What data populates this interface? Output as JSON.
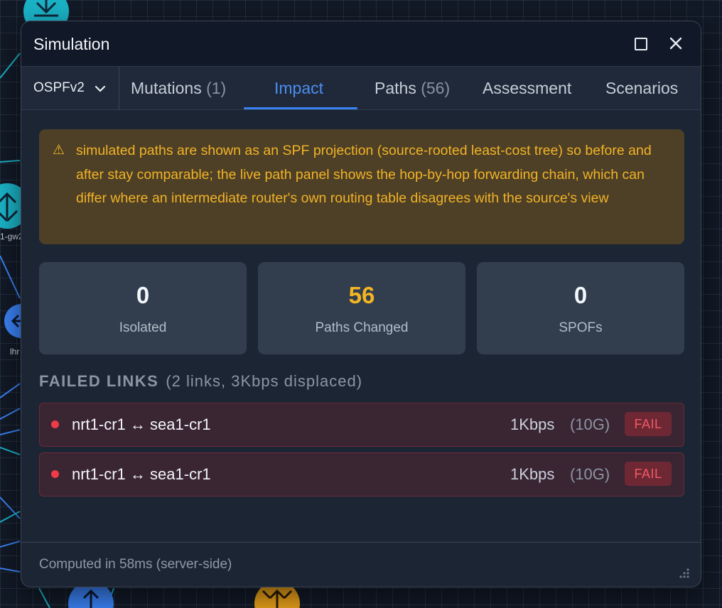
{
  "colors": {
    "accent": "#3b82f6",
    "warning_text": "#f2b227",
    "warning_bg": "#4d4026",
    "fail_red": "#ef3b47",
    "panel_bg": "#1c2534",
    "teal_node": "#1bb3c7",
    "blue_node": "#3b82f6",
    "orange_node": "#e8a01a"
  },
  "background": {
    "node_labels": [
      "1-gw2",
      "lhr"
    ]
  },
  "window": {
    "title": "Simulation",
    "maximize_icon": "maximize-icon",
    "close_icon": "close-icon"
  },
  "tabs": {
    "protocol": {
      "label": "OSPFv2",
      "icon": "chevron-down-icon"
    },
    "items": [
      {
        "label": "Mutations",
        "count": "(1)"
      },
      {
        "label": "Impact",
        "count": ""
      },
      {
        "label": "Paths",
        "count": "(56)"
      },
      {
        "label": "Assessment",
        "count": ""
      },
      {
        "label": "Scenarios",
        "count": ""
      }
    ],
    "active": "Impact"
  },
  "warning": {
    "icon": "⚠",
    "text": "simulated paths are shown as an SPF projection (source-rooted least-cost tree) so before and after stay comparable; the live path panel shows the hop-by-hop forwarding chain, which can differ where an intermediate router's own routing table disagrees with the source's view"
  },
  "stats": [
    {
      "value": "0",
      "label": "Isolated",
      "highlight": false
    },
    {
      "value": "56",
      "label": "Paths Changed",
      "highlight": true
    },
    {
      "value": "0",
      "label": "SPOFs",
      "highlight": false
    }
  ],
  "failed_links": {
    "title": "FAILED LINKS",
    "summary": "(2 links, 3Kbps displaced)",
    "rows": [
      {
        "a": "nrt1-cr1",
        "arrow": "↔",
        "b": "sea1-cr1",
        "rate": "1Kbps",
        "capacity": "(10G)",
        "status": "FAIL"
      },
      {
        "a": "nrt1-cr1",
        "arrow": "↔",
        "b": "sea1-cr1",
        "rate": "1Kbps",
        "capacity": "(10G)",
        "status": "FAIL"
      }
    ]
  },
  "footer": {
    "text": "Computed in 58ms (server-side)",
    "resize_icon": "resize-grip-icon"
  }
}
